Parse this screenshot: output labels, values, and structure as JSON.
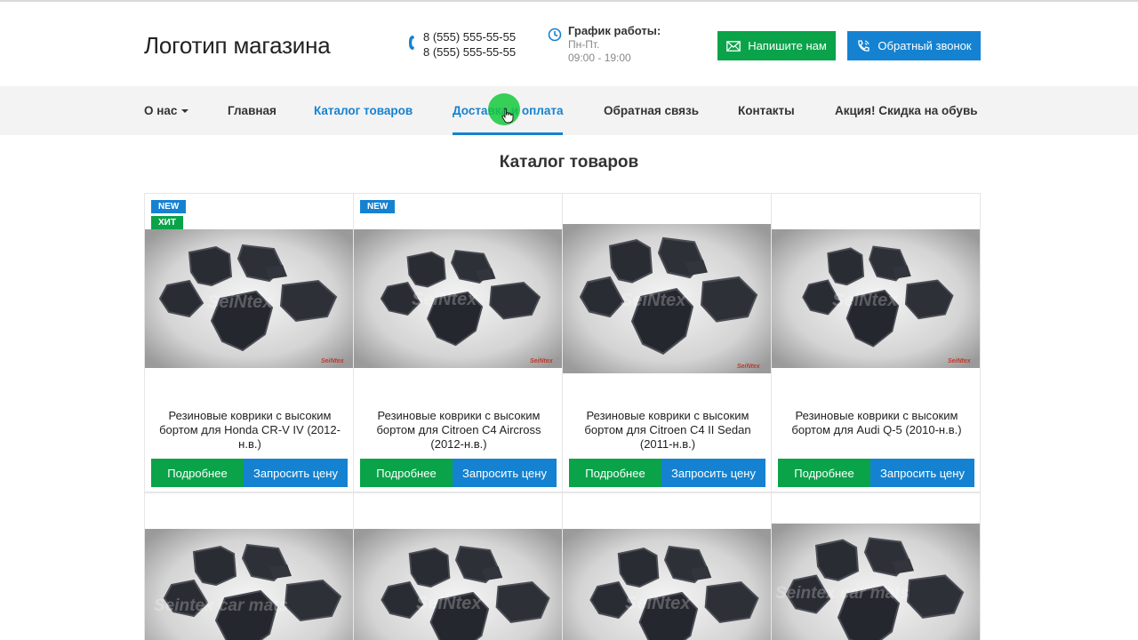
{
  "header": {
    "logo": "Логотип магазина",
    "phones": [
      "8 (555) 555-55-55",
      "8 (555) 555-55-55"
    ],
    "schedule_title": "График работы:",
    "schedule_days": "Пн-Пт.",
    "schedule_hours": "09:00 - 19:00",
    "write_button": "Напишите нам",
    "call_button": "Обратный звонок"
  },
  "nav": {
    "items": [
      {
        "label": "О нас"
      },
      {
        "label": "Главная"
      },
      {
        "label": "Каталог товаров"
      },
      {
        "label": "Доставка и оплата"
      },
      {
        "label": "Обратная связь"
      },
      {
        "label": "Контакты"
      },
      {
        "label": "Акция! Скидка на обувь"
      }
    ]
  },
  "page_title": "Каталог товаров",
  "products": [
    {
      "badges": [
        "NEW",
        "ХИТ"
      ],
      "title": "Резиновые коврики с высоким бортом для Honda CR-V IV (2012-н.в.)",
      "more": "Подробнее",
      "price": "Запросить цену",
      "watermark": "SeiNtex",
      "brand": "SeiNtex"
    },
    {
      "badges": [
        "NEW"
      ],
      "title": "Резиновые коврики с высоким бортом для Citroen C4 Aircross (2012-н.в.)",
      "more": "Подробнее",
      "price": "Запросить цену",
      "watermark": "SeiNtex",
      "brand": "SeiNtex"
    },
    {
      "badges": [],
      "title": "Резиновые коврики с высоким бортом для Citroen C4 II Sedan (2011-н.в.)",
      "more": "Подробнее",
      "price": "Запросить цену",
      "watermark": "SeiNtex",
      "brand": "SeiNtex"
    },
    {
      "badges": [],
      "title": "Резиновые коврики с высоким бортом для Audi Q-5 (2010-н.в.)",
      "more": "Подробнее",
      "price": "Запросить цену",
      "watermark": "SeiNtex",
      "brand": "SeiNtex"
    },
    {
      "badges": [],
      "watermark": "Seintex car mats"
    },
    {
      "badges": [],
      "watermark": "SeiNtex"
    },
    {
      "badges": [],
      "watermark": "SeiNtex"
    },
    {
      "badges": [],
      "watermark": "Seintex car mats"
    }
  ],
  "colors": {
    "green": "#0aa34a",
    "blue": "#1582d1",
    "nav_bg": "#f3f3f3"
  },
  "icons": {
    "phone": "phone-icon",
    "clock": "clock-icon",
    "mail": "envelope-icon",
    "call": "phone-call-icon"
  }
}
